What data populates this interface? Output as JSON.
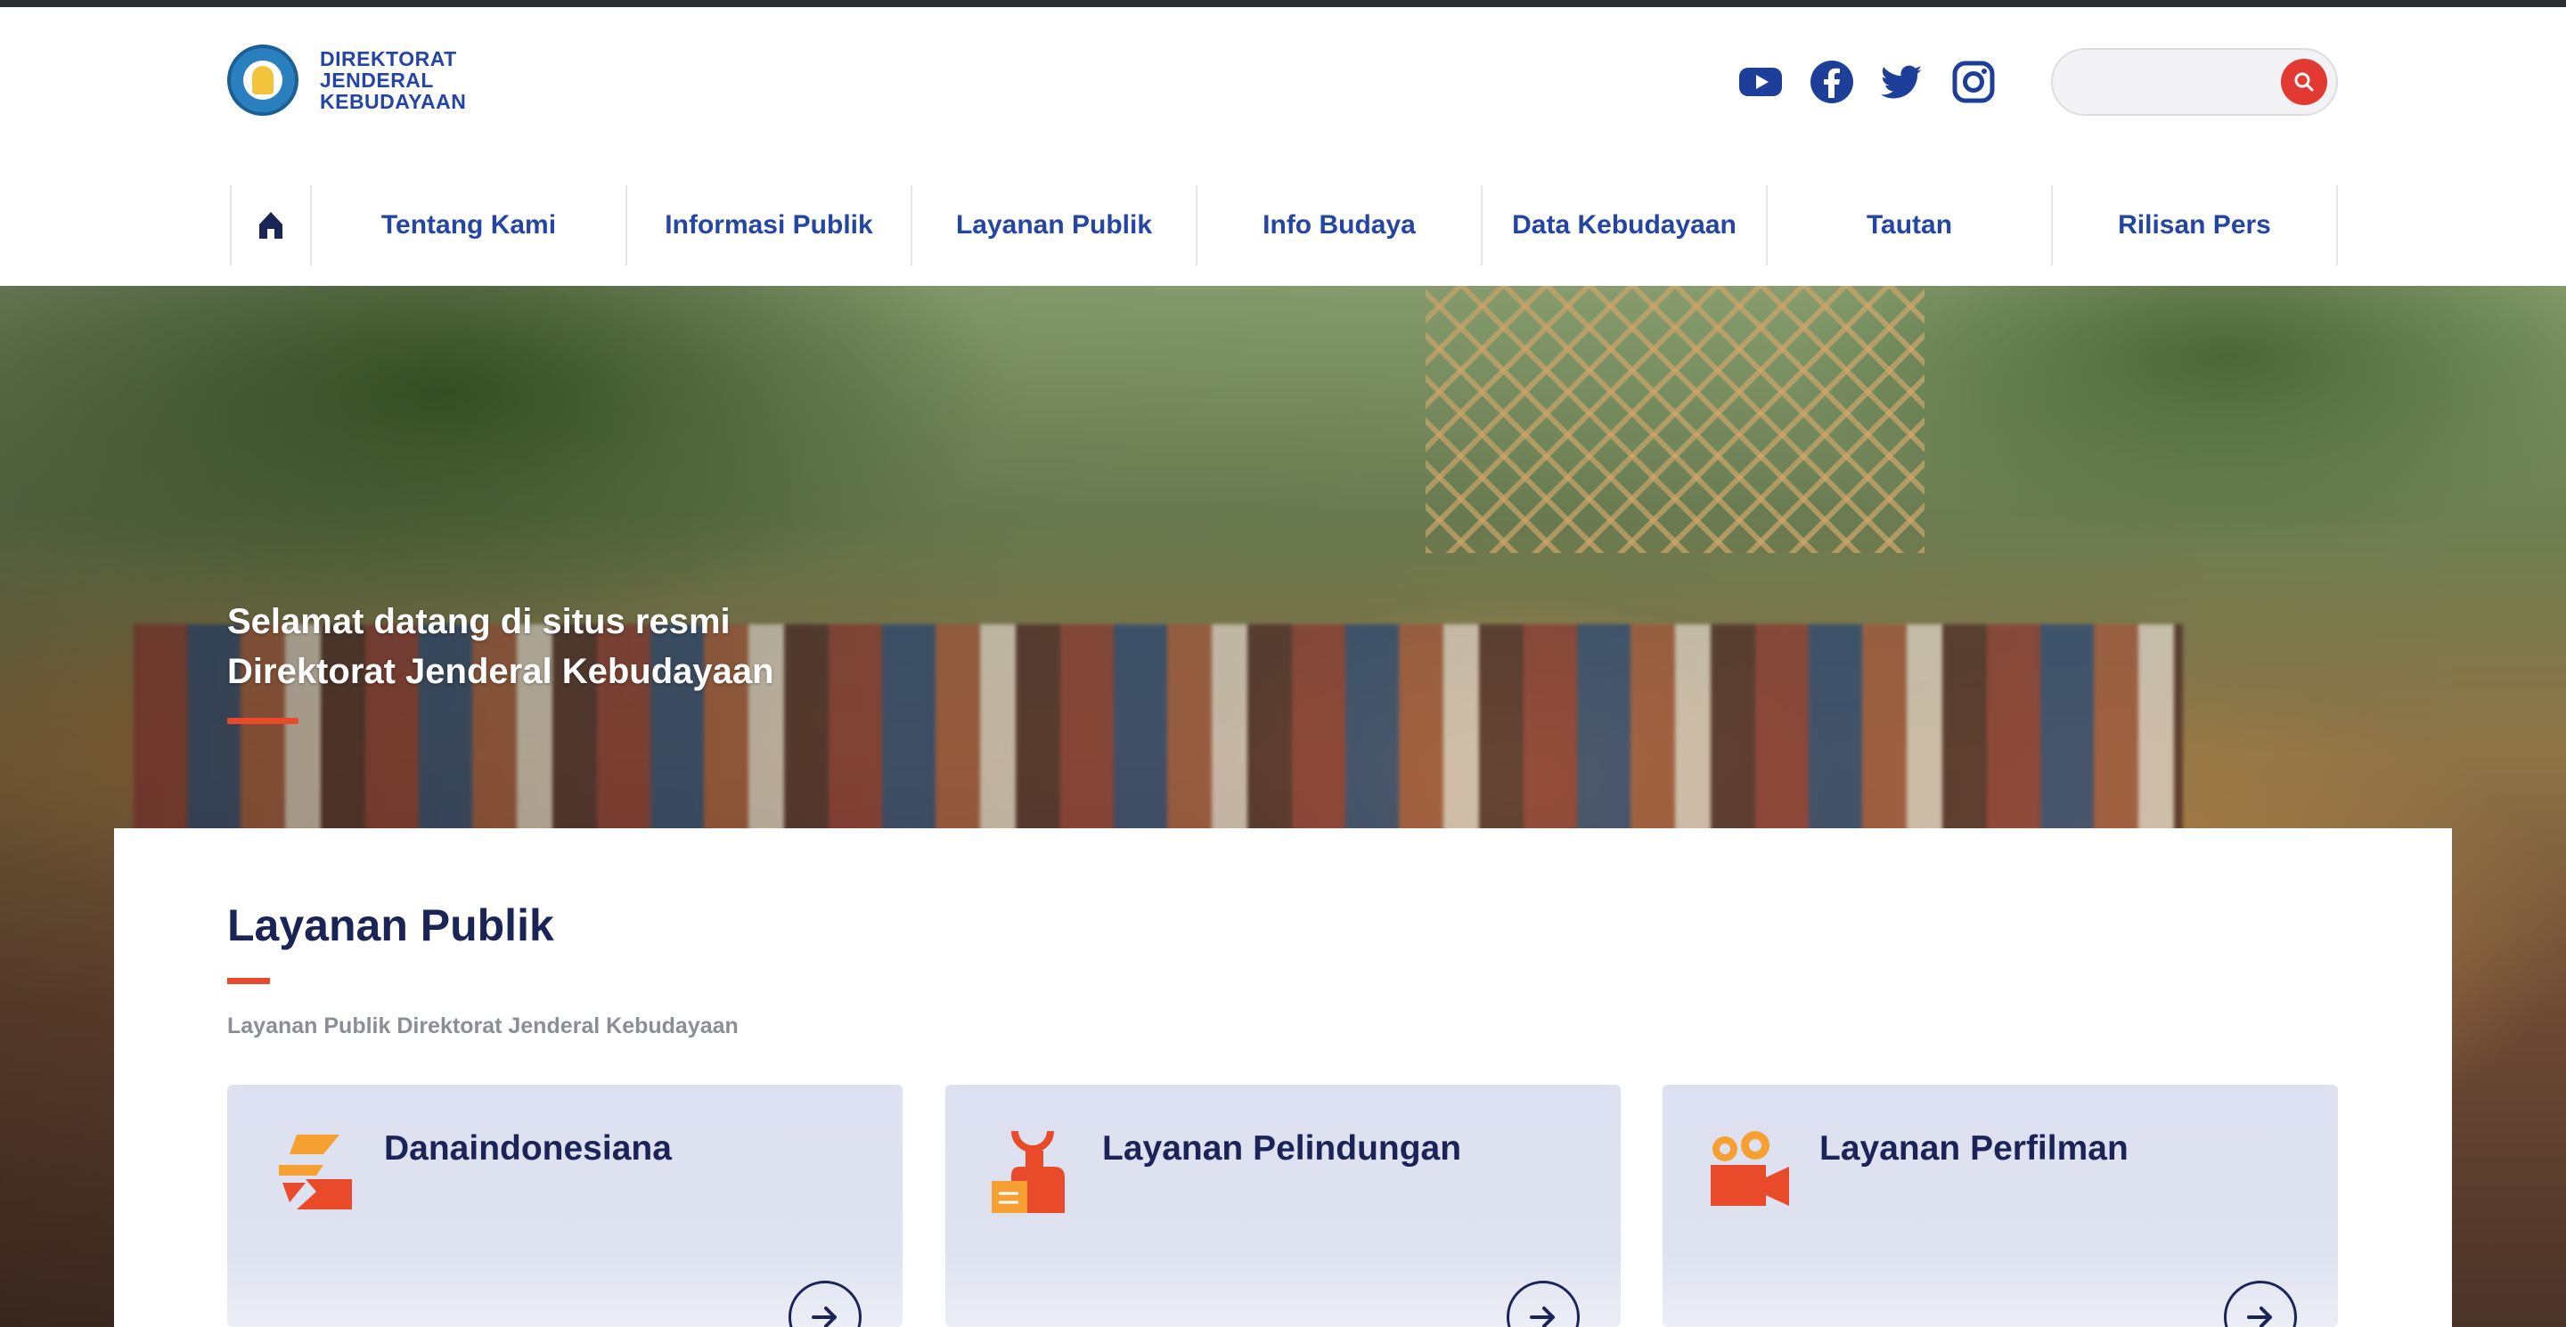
{
  "logo": {
    "line1": "DIREKTORAT",
    "line2": "JENDERAL",
    "line3": "KEBUDAYAAN"
  },
  "social": [
    "youtube-icon",
    "facebook-icon",
    "twitter-icon",
    "instagram-icon"
  ],
  "search": {
    "placeholder": "",
    "value": ""
  },
  "nav": {
    "items": [
      {
        "label": "Tentang Kami"
      },
      {
        "label": "Informasi Publik"
      },
      {
        "label": "Layanan Publik"
      },
      {
        "label": "Info Budaya"
      },
      {
        "label": "Data Kebudayaan"
      },
      {
        "label": "Tautan"
      },
      {
        "label": "Rilisan Pers"
      }
    ]
  },
  "hero": {
    "line1": "Selamat datang di situs resmi",
    "line2": "Direktorat Jenderal Kebudayaan"
  },
  "section": {
    "title": "Layanan Publik",
    "subtitle": "Layanan Publik Direktorat Jenderal Kebudayaan",
    "cards": [
      {
        "label": "Danaindonesiana",
        "icon": "hand-coin-icon"
      },
      {
        "label": "Layanan Pelindungan",
        "icon": "protection-icon"
      },
      {
        "label": "Layanan Perfilman",
        "icon": "film-camera-icon"
      }
    ]
  },
  "colors": {
    "brand_blue": "#2445a3",
    "navy": "#1a2457",
    "accent_red": "#e84a2a",
    "search_red": "#e23a33",
    "card_bg": "#dde0f0"
  }
}
